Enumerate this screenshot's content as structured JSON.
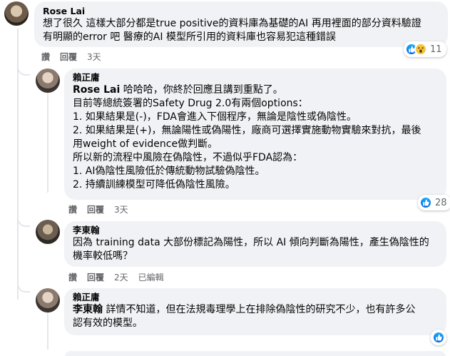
{
  "comments": [
    {
      "author": "Rose Lai",
      "text": "想了很久 這樣大部分都是true positive的資料庫為基礎的AI 再用裡面的部分資料驗證\n有明顯的error 吧 醫療的AI 模型所引用的資料庫也容易犯這種錯誤",
      "actions": {
        "like": "讚",
        "reply": "回覆",
        "time": "3天"
      },
      "reactions": {
        "count": "11",
        "icons": [
          "like-icon",
          "wow-icon"
        ]
      }
    },
    {
      "author": "賴正庸",
      "mention": "Rose Lai",
      "text_after_mention": " 哈哈哈，你終於回應且講到重點了。",
      "text": "目前等總統簽署的Safety Drug 2.0有兩個options：\n1. 如果結果是(-)，FDA會進入下個程序，無論是陰性或偽陰性。\n2. 如果結果是(+)，無論陽性或偽陽性，廠商可選擇實施動物實驗來對抗，最後\n用weight of evidence做判斷。\n所以新的流程中風險在偽陰性，不過似乎FDA認為：\n1. AI偽陰性風險低於傳統動物試驗偽陰性。\n2. 持續訓練模型可降低偽陰性風險。",
      "actions": {
        "like": "讚",
        "reply": "回覆",
        "time": "3天"
      },
      "reactions": {
        "count": "28",
        "icons": [
          "like-icon"
        ]
      }
    },
    {
      "author": "李東翰",
      "text": "因為 training data 大部份標記為陽性，所以 AI 傾向判斷為陽性，產生偽陰性的\n機率較低嗎？",
      "actions": {
        "like": "讚",
        "reply": "回覆",
        "time": "2天",
        "edited": "已編輯"
      }
    },
    {
      "author": "賴正庸",
      "mention": "李東翰",
      "text_after_mention": " 詳情不知道，但在法規毒理學上在排除偽陰性的研究不少，也有許多公\n認有效的模型。",
      "reactions": {
        "icons": [
          "like-icon"
        ]
      }
    }
  ],
  "colors": {
    "bubble": "#f0f2f5",
    "meta": "#65676b",
    "like": "#0866ff"
  }
}
